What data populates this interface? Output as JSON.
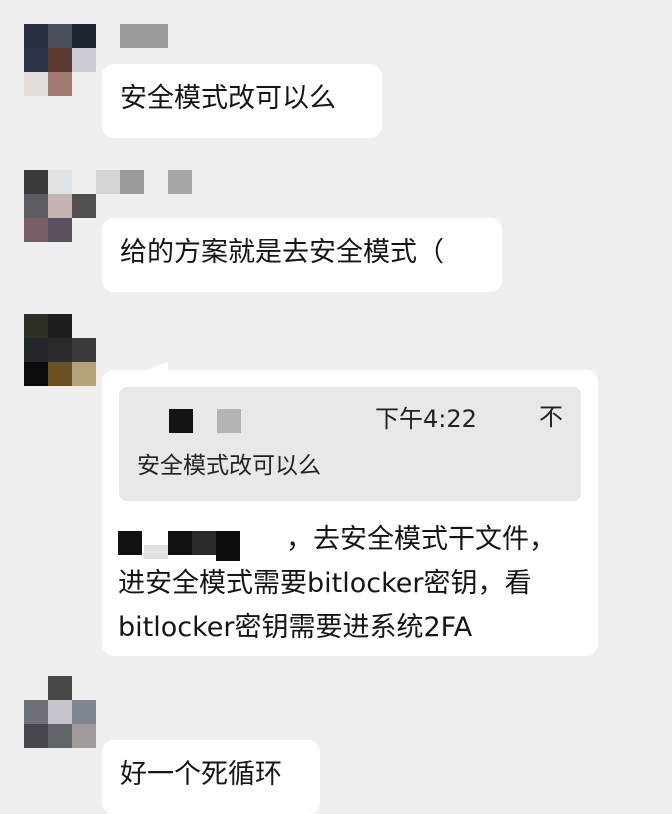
{
  "messages": [
    {
      "text": "安全模式改可以么"
    },
    {
      "text": "给的方案就是去安全模式（"
    },
    {
      "quote": {
        "time": "下午4:22",
        "collapse_icon": "不",
        "text": "安全模式改可以么"
      },
      "lines": [
        "，去安全模式干文件，",
        "进安全模式需要bitlocker密钥，看",
        "bitlocker密钥需要进系统2FA"
      ]
    },
    {
      "text": "好一个死循环"
    }
  ],
  "colors": {
    "background": "#efefef",
    "bubble": "#ffffff",
    "quote_bg": "#e8e8e8"
  }
}
